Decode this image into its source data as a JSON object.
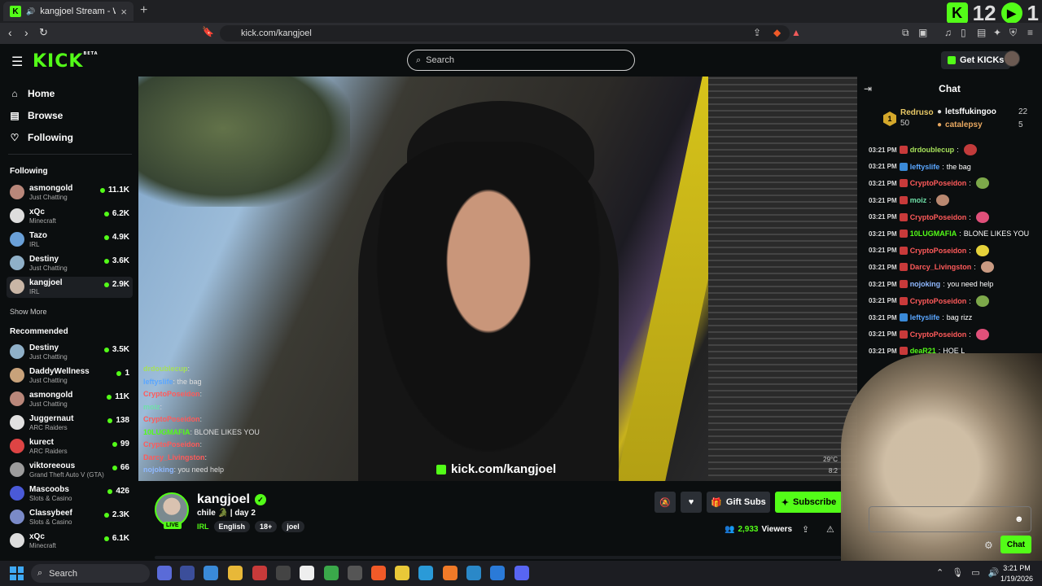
{
  "browser": {
    "tab_title": "kangjoel Stream - Watch Live",
    "url": "kick.com/kangjoel",
    "overlay_counter": "12",
    "overlay_counter_right": "1"
  },
  "header": {
    "logo": "KICK",
    "logo_beta": "BETA",
    "search_placeholder": "Search",
    "get_kicks": "Get KICKs"
  },
  "sidebar": {
    "nav": [
      {
        "label": "Home",
        "icon": "home-icon"
      },
      {
        "label": "Browse",
        "icon": "browse-icon"
      },
      {
        "label": "Following",
        "icon": "heart-icon"
      }
    ],
    "following_title": "Following",
    "following": [
      {
        "name": "asmongold",
        "category": "Just Chatting",
        "viewers": "11.1K",
        "color": "#b9877a"
      },
      {
        "name": "xQc",
        "category": "Minecraft",
        "viewers": "6.2K",
        "color": "#dddddd"
      },
      {
        "name": "Tazo",
        "category": "IRL",
        "viewers": "4.9K",
        "color": "#6aa0d8"
      },
      {
        "name": "Destiny",
        "category": "Just Chatting",
        "viewers": "3.6K",
        "color": "#8fb0c8"
      },
      {
        "name": "kangjoel",
        "category": "IRL",
        "viewers": "2.9K",
        "color": "#c9b6a6"
      }
    ],
    "show_more": "Show More",
    "recommended_title": "Recommended",
    "recommended": [
      {
        "name": "Destiny",
        "category": "Just Chatting",
        "viewers": "3.5K",
        "color": "#8fb0c8"
      },
      {
        "name": "DaddyWellness",
        "category": "Just Chatting",
        "viewers": "1",
        "color": "#c8a27a"
      },
      {
        "name": "asmongold",
        "category": "Just Chatting",
        "viewers": "11K",
        "color": "#b9877a"
      },
      {
        "name": "Juggernaut",
        "category": "ARC Raiders",
        "viewers": "138",
        "color": "#e0e0e0"
      },
      {
        "name": "kurect",
        "category": "ARC Raiders",
        "viewers": "99",
        "color": "#d44"
      },
      {
        "name": "viktoreeous",
        "category": "Grand Theft Auto V (GTA)",
        "viewers": "66",
        "color": "#9c9c9c"
      },
      {
        "name": "Mascoobs",
        "category": "Slots & Casino",
        "viewers": "426",
        "color": "#4a5ad8"
      },
      {
        "name": "Classybeef",
        "category": "Slots & Casino",
        "viewers": "2.3K",
        "color": "#7a8ac8"
      },
      {
        "name": "xQc",
        "category": "Minecraft",
        "viewers": "6.1K",
        "color": "#dddddd"
      }
    ]
  },
  "video": {
    "watermark": "kick.com/kangjoel",
    "temp": "29°C",
    "time_partial": "8:2",
    "overlay_chat": [
      {
        "user": "drdoublecup",
        "text": "",
        "color": "#a6e05a"
      },
      {
        "user": "leftyslife",
        "text": "the bag",
        "color": "#5aa6ff"
      },
      {
        "user": "CryptoPoseidon",
        "text": "",
        "color": "#ff5a5a"
      },
      {
        "user": "moiz",
        "text": "",
        "color": "#6fe0a8"
      },
      {
        "user": "CryptoPoseidon",
        "text": "",
        "color": "#ff5a5a"
      },
      {
        "user": "10LUGMAFIA",
        "text": "BLONE LIKES YOU",
        "color": "#53fc18"
      },
      {
        "user": "CryptoPoseidon",
        "text": "",
        "color": "#ff5a5a"
      },
      {
        "user": "Darcy_Livingston",
        "text": "",
        "color": "#ff5a5a"
      },
      {
        "user": "nojoking",
        "text": "you need help",
        "color": "#8fb8ff"
      }
    ]
  },
  "stream": {
    "name": "kangjoel",
    "title": "chile 🐊 | day 2",
    "category": "IRL",
    "tags": [
      "English",
      "18+",
      "joel"
    ],
    "live": "LIVE",
    "viewers": "2,933",
    "viewers_label": "Viewers",
    "gift_label": "Gift Subs",
    "subscribe_label": "Subscribe"
  },
  "chat": {
    "title": "Chat",
    "leader1": {
      "rank": "1",
      "name": "Redruso",
      "count": "50"
    },
    "leader2": {
      "name": "letsffukingoo",
      "count": "22"
    },
    "leader3": {
      "name": "catalepsy",
      "count": "5"
    },
    "messages": [
      {
        "ts": "03:21 PM",
        "user": "drdoublecup",
        "text": "",
        "color": "#a6e05a",
        "emote": "#c23b3b"
      },
      {
        "ts": "03:21 PM",
        "user": "leftyslife",
        "text": "the bag",
        "color": "#5aa6ff",
        "emote": ""
      },
      {
        "ts": "03:21 PM",
        "user": "CryptoPoseidon",
        "text": "",
        "color": "#ff5a5a",
        "emote": "#7da84a"
      },
      {
        "ts": "03:21 PM",
        "user": "moiz",
        "text": "",
        "color": "#6fe0a8",
        "emote": "#b98870"
      },
      {
        "ts": "03:21 PM",
        "user": "CryptoPoseidon",
        "text": "",
        "color": "#ff5a5a",
        "emote": "#e0507a"
      },
      {
        "ts": "03:21 PM",
        "user": "10LUGMAFIA",
        "text": "BLONE LIKES YOU",
        "color": "#53fc18",
        "emote": ""
      },
      {
        "ts": "03:21 PM",
        "user": "CryptoPoseidon",
        "text": "",
        "color": "#ff5a5a",
        "emote": "#e6d23a"
      },
      {
        "ts": "03:21 PM",
        "user": "Darcy_Livingston",
        "text": "",
        "color": "#ff5a5a",
        "emote": "#c99a82"
      },
      {
        "ts": "03:21 PM",
        "user": "nojoking",
        "text": "you need help",
        "color": "#8fb8ff",
        "emote": ""
      },
      {
        "ts": "03:21 PM",
        "user": "CryptoPoseidon",
        "text": "",
        "color": "#ff5a5a",
        "emote": "#7da84a"
      },
      {
        "ts": "03:21 PM",
        "user": "leftyslife",
        "text": "bag rizz",
        "color": "#5aa6ff",
        "emote": ""
      },
      {
        "ts": "03:21 PM",
        "user": "CryptoPoseidon",
        "text": "",
        "color": "#ff5a5a",
        "emote": "#e0507a"
      },
      {
        "ts": "03:21 PM",
        "user": "deaR21",
        "text": "HOE L",
        "color": "#53fc18",
        "emote": ""
      }
    ],
    "send_label": "Chat"
  },
  "taskbar": {
    "search": "Search",
    "time": "3:21 PM",
    "date": "1/19/2026"
  }
}
